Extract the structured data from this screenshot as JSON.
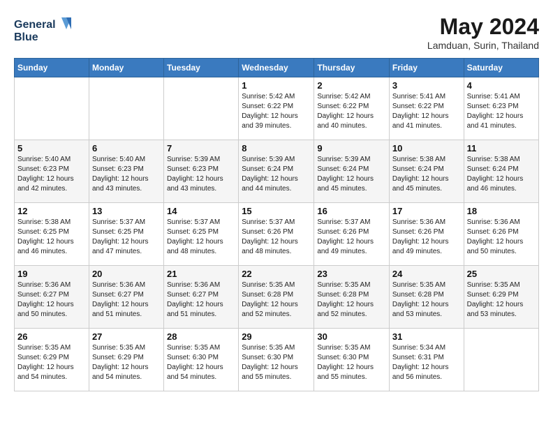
{
  "header": {
    "logo_line1": "General",
    "logo_line2": "Blue",
    "month_year": "May 2024",
    "location": "Lamduan, Surin, Thailand"
  },
  "weekdays": [
    "Sunday",
    "Monday",
    "Tuesday",
    "Wednesday",
    "Thursday",
    "Friday",
    "Saturday"
  ],
  "weeks": [
    [
      {
        "day": "",
        "info": ""
      },
      {
        "day": "",
        "info": ""
      },
      {
        "day": "",
        "info": ""
      },
      {
        "day": "1",
        "info": "Sunrise: 5:42 AM\nSunset: 6:22 PM\nDaylight: 12 hours\nand 39 minutes."
      },
      {
        "day": "2",
        "info": "Sunrise: 5:42 AM\nSunset: 6:22 PM\nDaylight: 12 hours\nand 40 minutes."
      },
      {
        "day": "3",
        "info": "Sunrise: 5:41 AM\nSunset: 6:22 PM\nDaylight: 12 hours\nand 41 minutes."
      },
      {
        "day": "4",
        "info": "Sunrise: 5:41 AM\nSunset: 6:23 PM\nDaylight: 12 hours\nand 41 minutes."
      }
    ],
    [
      {
        "day": "5",
        "info": "Sunrise: 5:40 AM\nSunset: 6:23 PM\nDaylight: 12 hours\nand 42 minutes."
      },
      {
        "day": "6",
        "info": "Sunrise: 5:40 AM\nSunset: 6:23 PM\nDaylight: 12 hours\nand 43 minutes."
      },
      {
        "day": "7",
        "info": "Sunrise: 5:39 AM\nSunset: 6:23 PM\nDaylight: 12 hours\nand 43 minutes."
      },
      {
        "day": "8",
        "info": "Sunrise: 5:39 AM\nSunset: 6:24 PM\nDaylight: 12 hours\nand 44 minutes."
      },
      {
        "day": "9",
        "info": "Sunrise: 5:39 AM\nSunset: 6:24 PM\nDaylight: 12 hours\nand 45 minutes."
      },
      {
        "day": "10",
        "info": "Sunrise: 5:38 AM\nSunset: 6:24 PM\nDaylight: 12 hours\nand 45 minutes."
      },
      {
        "day": "11",
        "info": "Sunrise: 5:38 AM\nSunset: 6:24 PM\nDaylight: 12 hours\nand 46 minutes."
      }
    ],
    [
      {
        "day": "12",
        "info": "Sunrise: 5:38 AM\nSunset: 6:25 PM\nDaylight: 12 hours\nand 46 minutes."
      },
      {
        "day": "13",
        "info": "Sunrise: 5:37 AM\nSunset: 6:25 PM\nDaylight: 12 hours\nand 47 minutes."
      },
      {
        "day": "14",
        "info": "Sunrise: 5:37 AM\nSunset: 6:25 PM\nDaylight: 12 hours\nand 48 minutes."
      },
      {
        "day": "15",
        "info": "Sunrise: 5:37 AM\nSunset: 6:26 PM\nDaylight: 12 hours\nand 48 minutes."
      },
      {
        "day": "16",
        "info": "Sunrise: 5:37 AM\nSunset: 6:26 PM\nDaylight: 12 hours\nand 49 minutes."
      },
      {
        "day": "17",
        "info": "Sunrise: 5:36 AM\nSunset: 6:26 PM\nDaylight: 12 hours\nand 49 minutes."
      },
      {
        "day": "18",
        "info": "Sunrise: 5:36 AM\nSunset: 6:26 PM\nDaylight: 12 hours\nand 50 minutes."
      }
    ],
    [
      {
        "day": "19",
        "info": "Sunrise: 5:36 AM\nSunset: 6:27 PM\nDaylight: 12 hours\nand 50 minutes."
      },
      {
        "day": "20",
        "info": "Sunrise: 5:36 AM\nSunset: 6:27 PM\nDaylight: 12 hours\nand 51 minutes."
      },
      {
        "day": "21",
        "info": "Sunrise: 5:36 AM\nSunset: 6:27 PM\nDaylight: 12 hours\nand 51 minutes."
      },
      {
        "day": "22",
        "info": "Sunrise: 5:35 AM\nSunset: 6:28 PM\nDaylight: 12 hours\nand 52 minutes."
      },
      {
        "day": "23",
        "info": "Sunrise: 5:35 AM\nSunset: 6:28 PM\nDaylight: 12 hours\nand 52 minutes."
      },
      {
        "day": "24",
        "info": "Sunrise: 5:35 AM\nSunset: 6:28 PM\nDaylight: 12 hours\nand 53 minutes."
      },
      {
        "day": "25",
        "info": "Sunrise: 5:35 AM\nSunset: 6:29 PM\nDaylight: 12 hours\nand 53 minutes."
      }
    ],
    [
      {
        "day": "26",
        "info": "Sunrise: 5:35 AM\nSunset: 6:29 PM\nDaylight: 12 hours\nand 54 minutes."
      },
      {
        "day": "27",
        "info": "Sunrise: 5:35 AM\nSunset: 6:29 PM\nDaylight: 12 hours\nand 54 minutes."
      },
      {
        "day": "28",
        "info": "Sunrise: 5:35 AM\nSunset: 6:30 PM\nDaylight: 12 hours\nand 54 minutes."
      },
      {
        "day": "29",
        "info": "Sunrise: 5:35 AM\nSunset: 6:30 PM\nDaylight: 12 hours\nand 55 minutes."
      },
      {
        "day": "30",
        "info": "Sunrise: 5:35 AM\nSunset: 6:30 PM\nDaylight: 12 hours\nand 55 minutes."
      },
      {
        "day": "31",
        "info": "Sunrise: 5:34 AM\nSunset: 6:31 PM\nDaylight: 12 hours\nand 56 minutes."
      },
      {
        "day": "",
        "info": ""
      }
    ]
  ]
}
